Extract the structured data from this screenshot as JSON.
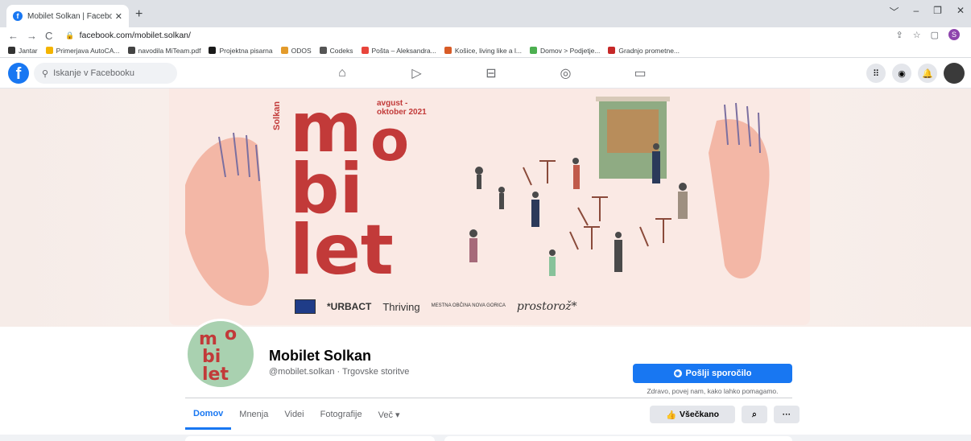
{
  "browser": {
    "tab_title": "Mobilet Solkan | Facebook",
    "tab_close": "✕",
    "new_tab": "+",
    "window_controls": [
      "﹀",
      "–",
      "❐",
      "✕"
    ],
    "back": "←",
    "forward": "→",
    "reload": "C",
    "url": "facebook.com/mobilet.solkan/",
    "profile_initial": "S",
    "bookmarks": [
      {
        "label": "Jantar",
        "color": "#333333"
      },
      {
        "label": "Primerjava AutoCA...",
        "color": "#f4b400"
      },
      {
        "label": "navodila MiTeam.pdf",
        "color": "#444444"
      },
      {
        "label": "Projektna pisarna",
        "color": "#1a1a1a"
      },
      {
        "label": "ODOS",
        "color": "#e39b2b"
      },
      {
        "label": "Codeks",
        "color": "#555555"
      },
      {
        "label": "Pošta – Aleksandra...",
        "color": "#e8453c"
      },
      {
        "label": "Košice, living like a l...",
        "color": "#d85c27"
      },
      {
        "label": "Domov > Podjetje...",
        "color": "#4caf50"
      },
      {
        "label": "Gradnjo prometne...",
        "color": "#c62828"
      }
    ]
  },
  "fb": {
    "logo": "f",
    "search_placeholder": "Iskanje v Facebooku"
  },
  "cover": {
    "solkan_vertical": "Solkan",
    "dates_line1": "avgust -",
    "dates_line2": "oktober 2021",
    "word_m": "m",
    "word_o": "o",
    "word_bi": "bi",
    "word_let": "let",
    "logo_urbact": "*URBACT",
    "logo_thriving": "Thriving",
    "logo_mestna": "MESTNA OBČINA NOVA GORICA",
    "logo_prostor": "prostorož*"
  },
  "profile": {
    "pic_m": "m",
    "pic_o": "o",
    "pic_bi": "bi",
    "pic_let": "let",
    "name": "Mobilet Solkan",
    "handle": "@mobilet.solkan · Trgovske storitve",
    "send_label": "Pošlji sporočilo",
    "send_note": "Zdravo, povej nam, kako lahko pomagamo."
  },
  "tabs": [
    {
      "label": "Domov",
      "active": true
    },
    {
      "label": "Mnenja"
    },
    {
      "label": "Videi"
    },
    {
      "label": "Fotografije"
    },
    {
      "label": "Več ▾"
    }
  ],
  "actions": {
    "like_label": "Všečkano",
    "search_icon": "⌕",
    "more": "···"
  },
  "colors": {
    "fb_blue": "#1877f2",
    "brand_red": "#c23a39",
    "profile_green": "#a9d1b0"
  }
}
